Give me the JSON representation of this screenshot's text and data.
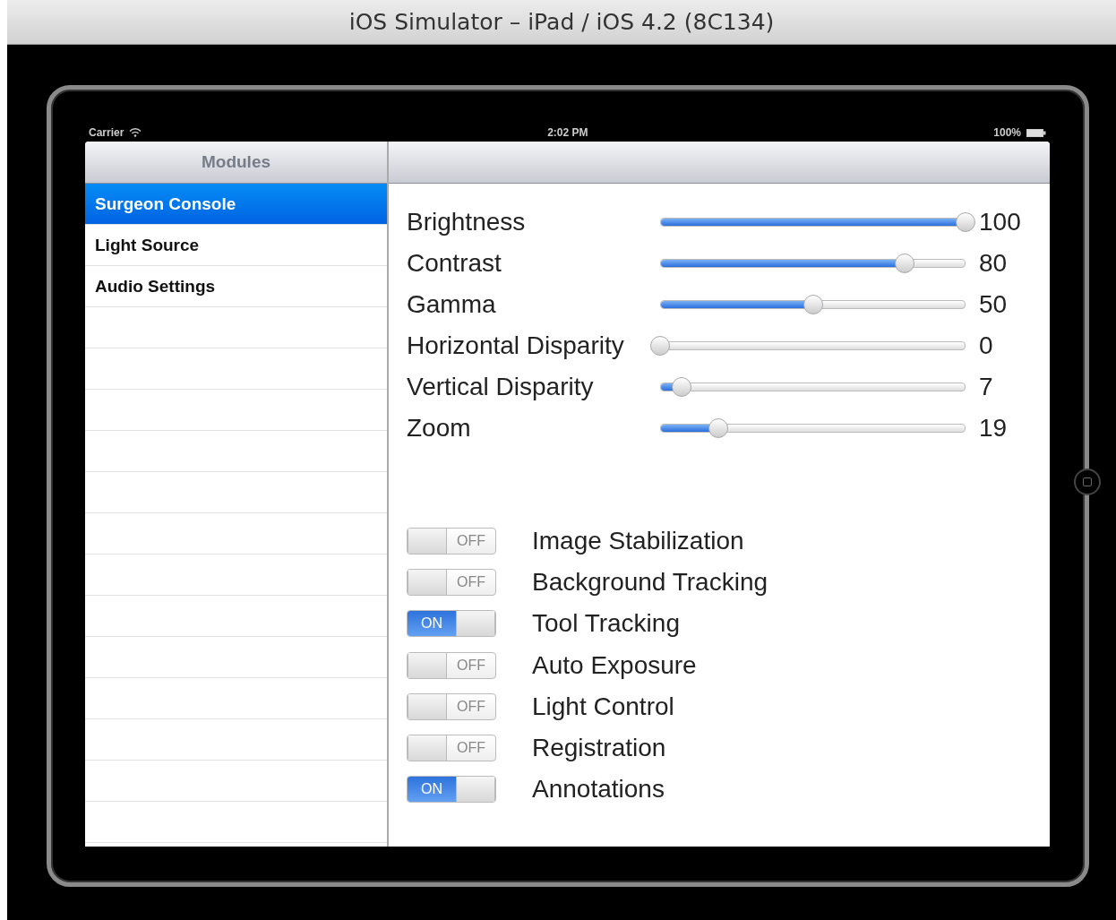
{
  "window": {
    "title": "iOS Simulator – iPad / iOS 4.2 (8C134)"
  },
  "status_bar": {
    "carrier": "Carrier",
    "time": "2:02 PM",
    "battery": "100%"
  },
  "sidebar": {
    "title": "Modules",
    "items": [
      {
        "label": "Surgeon Console",
        "selected": true
      },
      {
        "label": "Light Source",
        "selected": false
      },
      {
        "label": "Audio Settings",
        "selected": false
      }
    ]
  },
  "sliders": [
    {
      "label": "Brightness",
      "level": 1,
      "reading": "100"
    },
    {
      "label": "Contrast",
      "level": 0.8,
      "reading": "80"
    },
    {
      "label": "Gamma",
      "level": 0.5,
      "reading": "50"
    },
    {
      "label": "Horizontal Disparity",
      "level": 0,
      "reading": "0"
    },
    {
      "label": "Vertical Disparity",
      "level": 0.07,
      "reading": "7"
    },
    {
      "label": "Zoom",
      "level": 0.19,
      "reading": "19"
    }
  ],
  "switches": [
    {
      "label": "Image Stabilization",
      "on": false,
      "text": "OFF"
    },
    {
      "label": "Background Tracking",
      "on": false,
      "text": "OFF"
    },
    {
      "label": "Tool Tracking",
      "on": true,
      "text": "ON"
    },
    {
      "label": "Auto Exposure",
      "on": false,
      "text": "OFF"
    },
    {
      "label": "Light Control",
      "on": false,
      "text": "OFF"
    },
    {
      "label": "Registration",
      "on": false,
      "text": "OFF"
    },
    {
      "label": "Annotations",
      "on": true,
      "text": "ON"
    }
  ]
}
